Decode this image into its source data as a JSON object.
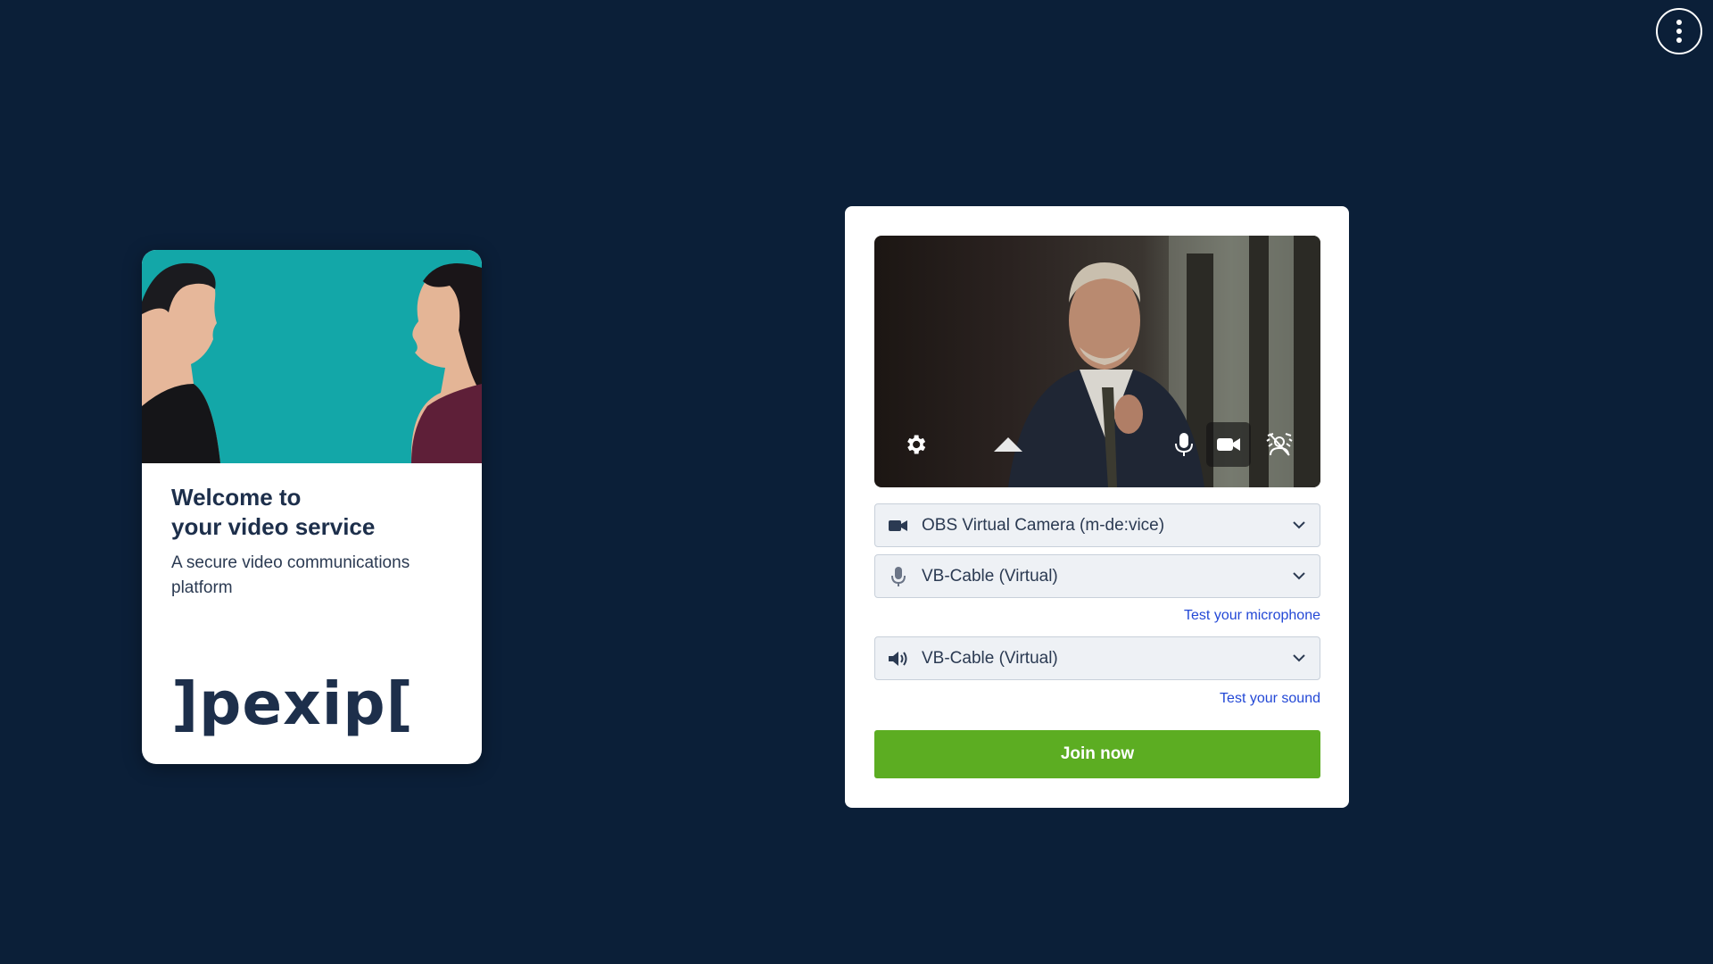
{
  "welcome": {
    "title_line1": "Welcome to",
    "title_line2": "your video service",
    "subtitle": "A secure video communications platform",
    "logo_text": "]pexip["
  },
  "header": {
    "menu_icon": "more-vertical-icon"
  },
  "preview": {
    "controls": [
      {
        "name": "settings",
        "icon": "gear-icon"
      },
      {
        "name": "self-view-toggle",
        "icon": "triangle-up-icon"
      },
      {
        "name": "microphone",
        "icon": "microphone-icon"
      },
      {
        "name": "camera",
        "icon": "video-camera-icon"
      },
      {
        "name": "background-effects",
        "icon": "background-blur-icon"
      }
    ]
  },
  "devices": {
    "camera": {
      "icon": "video-camera-icon",
      "value": "OBS Virtual Camera (m-de:vice)"
    },
    "microphone": {
      "icon": "microphone-icon",
      "value": "VB-Cable (Virtual)"
    },
    "speaker": {
      "icon": "speaker-icon",
      "value": "VB-Cable (Virtual)"
    }
  },
  "links": {
    "test_microphone": "Test your microphone",
    "test_sound": "Test your sound"
  },
  "actions": {
    "join_label": "Join now"
  },
  "colors": {
    "background": "#0b1f38",
    "join_button": "#5cad22",
    "link": "#2348d6",
    "hero": "#13a7a8"
  }
}
